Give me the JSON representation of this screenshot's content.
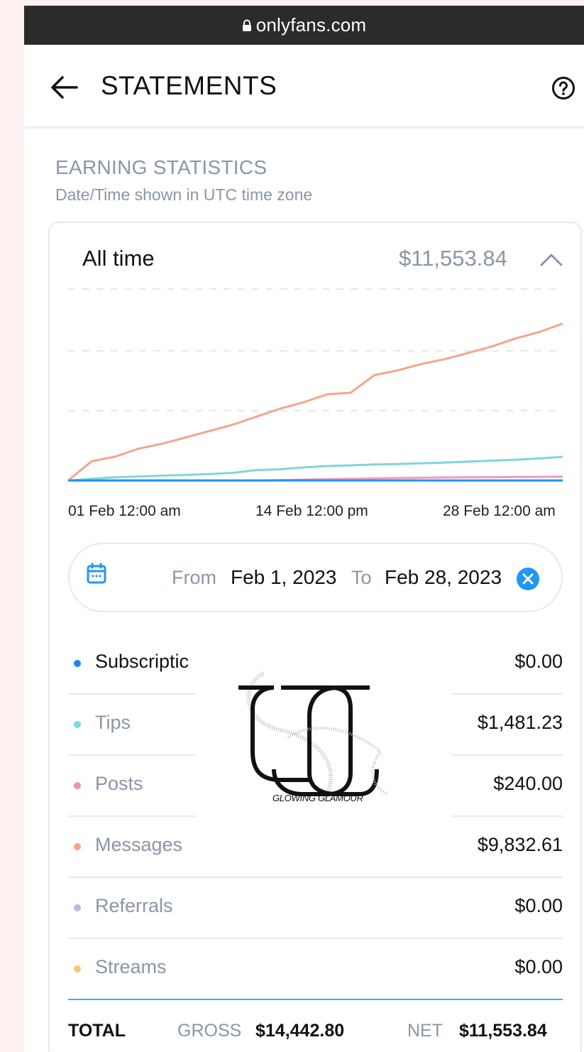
{
  "browser": {
    "url": "onlyfans.com"
  },
  "header": {
    "title": "STATEMENTS",
    "back_icon": "arrow-left-icon",
    "help_icon": "question-circle-icon"
  },
  "section": {
    "title": "EARNING STATISTICS",
    "subtitle": "Date/Time shown in UTC time zone"
  },
  "summary": {
    "period": "All time",
    "total": "$11,553.84"
  },
  "chart_data": {
    "type": "line",
    "x_ticks": [
      "01 Feb 12:00 am",
      "14 Feb 12:00 pm",
      "28 Feb 12:00 am"
    ],
    "grid": true,
    "y_range": [
      0,
      12500
    ],
    "series": [
      {
        "category": "Messages",
        "color": "#f4a58c",
        "values": [
          0,
          1200,
          1500,
          2000,
          2300,
          2700,
          3100,
          3500,
          4000,
          4500,
          4900,
          5400,
          5500,
          6600,
          6900,
          7300,
          7600,
          8000,
          8400,
          8900,
          9300,
          9832.61
        ]
      },
      {
        "category": "Tips",
        "color": "#7fd6dc",
        "values": [
          0,
          100,
          200,
          250,
          300,
          350,
          400,
          480,
          650,
          700,
          820,
          900,
          950,
          1000,
          1030,
          1080,
          1120,
          1180,
          1240,
          1300,
          1380,
          1481.23
        ]
      },
      {
        "category": "Posts",
        "color": "#f39ab6",
        "values": [
          0,
          0,
          0,
          0,
          0,
          0,
          0,
          0,
          0,
          20,
          50,
          80,
          100,
          130,
          150,
          170,
          190,
          200,
          210,
          220,
          230,
          240
        ]
      },
      {
        "category": "Subscriptions",
        "color": "#2196f3",
        "values": [
          0,
          0,
          0,
          0,
          0,
          0,
          0,
          0,
          0,
          0,
          0,
          0,
          0,
          0,
          0,
          0,
          0,
          0,
          0,
          0,
          0,
          0
        ]
      }
    ]
  },
  "date_range": {
    "from_label": "From",
    "from_value": "Feb 1, 2023",
    "to_label": "To",
    "to_value": "Feb 28, 2023",
    "calendar_icon": "calendar-icon",
    "clear_icon": "close-circle-icon"
  },
  "breakdown": [
    {
      "label": "Subscriptic",
      "amount": "$0.00",
      "color": "#1e88e5"
    },
    {
      "label": "Tips",
      "amount": "$1,481.23",
      "color": "#7fd6dc"
    },
    {
      "label": "Posts",
      "amount": "$240.00",
      "color": "#f48fb1"
    },
    {
      "label": "Messages",
      "amount": "$9,832.61",
      "color": "#f4a58c"
    },
    {
      "label": "Referrals",
      "amount": "$0.00",
      "color": "#c5b3e6"
    },
    {
      "label": "Streams",
      "amount": "$0.00",
      "color": "#f7cb6b"
    }
  ],
  "totals": {
    "total_label": "TOTAL",
    "gross_label": "GROSS",
    "gross_value": "$14,442.80",
    "net_label": "NET",
    "net_value": "$11,553.84"
  },
  "watermark": {
    "text": "GLOWING GLAMOUR"
  }
}
